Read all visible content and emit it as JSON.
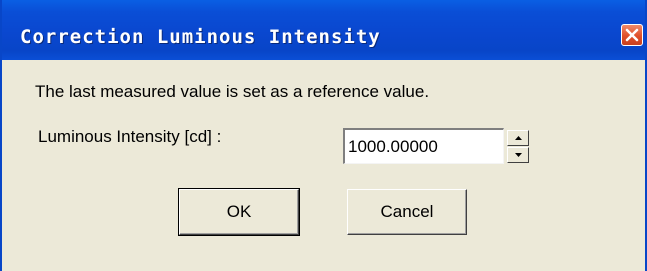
{
  "dialog": {
    "title": "Correction Luminous Intensity",
    "message": "The last measured value is set as a reference value.",
    "field": {
      "label": "Luminous Intensity [cd] :",
      "value": "1000.00000"
    },
    "buttons": {
      "ok_label": "OK",
      "cancel_label": "Cancel"
    },
    "icons": {
      "close": "close-icon",
      "spin_up": "arrow-up-icon",
      "spin_down": "arrow-down-icon"
    },
    "colors": {
      "titlebar": "#0a47cf",
      "close_button": "#e0502a",
      "dialog_background": "#ece9d8"
    }
  }
}
